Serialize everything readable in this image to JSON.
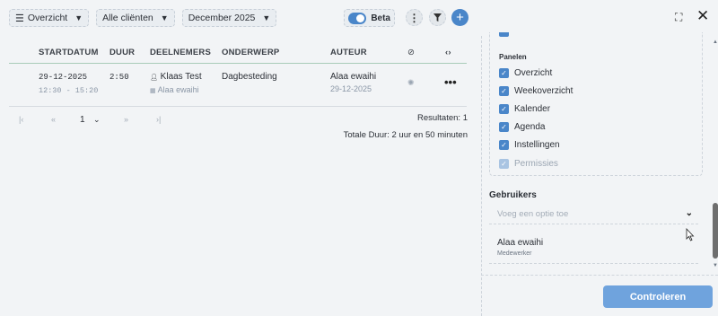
{
  "toolbar": {
    "view_label": "Overzicht",
    "clients_label": "Alle cliënten",
    "period_label": "December 2025",
    "beta_label": "Beta",
    "view_icon": "list-icon",
    "chevron_icon": "chevron-down-icon"
  },
  "table": {
    "headers": {
      "start": "STARTDATUM",
      "duration": "DUUR",
      "participants": "DEELNEMERS",
      "subject": "ONDERWERP",
      "author": "AUTEUR"
    },
    "rows": [
      {
        "date": "29-12-2025",
        "time": "12:30 - 15:20",
        "duration": "2:50",
        "client": "Klaas Test",
        "staff": "Alaa ewaihi",
        "subject": "Dagbesteding",
        "author": "Alaa ewaihi",
        "author_date": "29-12-2025"
      }
    ]
  },
  "pagination": {
    "page": "1",
    "results_label": "Resultaten:",
    "results_count": "1",
    "total_duration": "Totale Duur: 2 uur en 50 minuten"
  },
  "panel": {
    "title": "Panelen",
    "items": [
      {
        "label": "Overzicht",
        "checked": true
      },
      {
        "label": "Weekoverzicht",
        "checked": true
      },
      {
        "label": "Kalender",
        "checked": true
      },
      {
        "label": "Agenda",
        "checked": true
      },
      {
        "label": "Instellingen",
        "checked": true
      },
      {
        "label": "Permissies",
        "checked": true,
        "disabled": true
      }
    ]
  },
  "users": {
    "title": "Gebruikers",
    "placeholder": "Voeg een optie toe",
    "selected": {
      "name": "Alaa ewaihi",
      "role": "Medewerker"
    }
  },
  "footer": {
    "submit_label": "Controleren"
  },
  "colors": {
    "accent": "#4a86c9",
    "submit": "#6fa3dd",
    "background": "#f2f4f6"
  }
}
